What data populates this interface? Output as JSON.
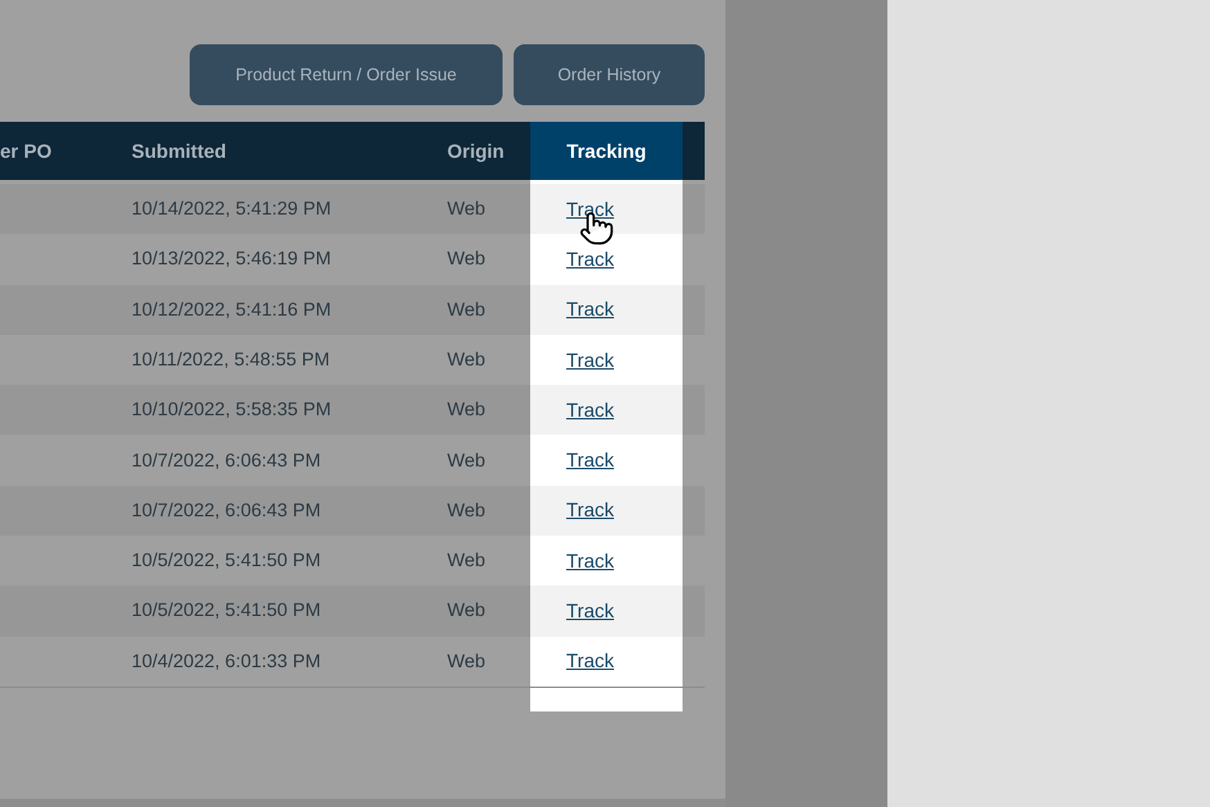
{
  "buttons": [
    {
      "label": "Product Return / Order Issue"
    },
    {
      "label": "Order History"
    }
  ],
  "table": {
    "columns": [
      {
        "label": "er PO",
        "highlighted": false
      },
      {
        "label": "Submitted",
        "highlighted": false
      },
      {
        "label": "Origin",
        "highlighted": false
      },
      {
        "label": "Tracking",
        "highlighted": true
      }
    ],
    "rows": [
      {
        "submitted": "10/14/2022, 5:41:29 PM",
        "origin": "Web",
        "tracking": "Track"
      },
      {
        "submitted": "10/13/2022, 5:46:19 PM",
        "origin": "Web",
        "tracking": "Track"
      },
      {
        "submitted": "10/12/2022, 5:41:16 PM",
        "origin": "Web",
        "tracking": "Track"
      },
      {
        "submitted": "10/11/2022, 5:48:55 PM",
        "origin": "Web",
        "tracking": "Track"
      },
      {
        "submitted": "10/10/2022, 5:58:35 PM",
        "origin": "Web",
        "tracking": "Track"
      },
      {
        "submitted": "10/7/2022, 6:06:43 PM",
        "origin": "Web",
        "tracking": "Track"
      },
      {
        "submitted": "10/7/2022, 6:06:43 PM",
        "origin": "Web",
        "tracking": "Track"
      },
      {
        "submitted": "10/5/2022, 5:41:50 PM",
        "origin": "Web",
        "tracking": "Track"
      },
      {
        "submitted": "10/5/2022, 5:41:50 PM",
        "origin": "Web",
        "tracking": "Track"
      },
      {
        "submitted": "10/4/2022, 6:01:33 PM",
        "origin": "Web",
        "tracking": "Track"
      }
    ]
  }
}
